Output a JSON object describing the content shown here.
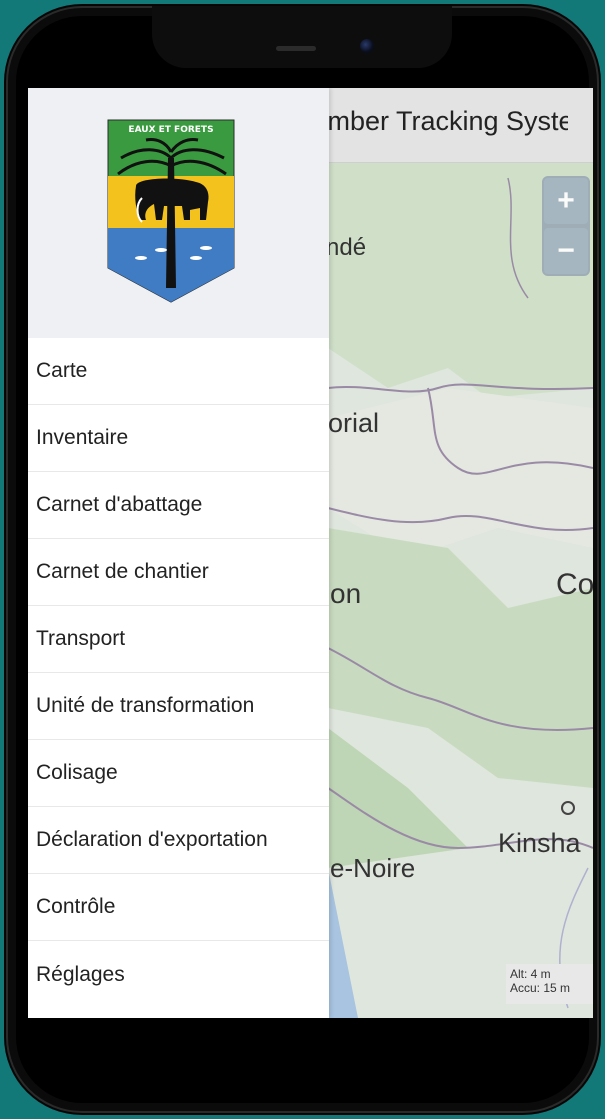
{
  "app": {
    "title_partial": "Timber Tracking System"
  },
  "map": {
    "zoom_in": "+",
    "zoom_out": "−",
    "labels": [
      "ndé",
      "orial",
      "on",
      "Co",
      "Kinsha",
      "e-Noire"
    ],
    "alt_text": "Alt: 4 m",
    "accu_text": "Accu: 15 m"
  },
  "drawer": {
    "emblem_text": "EAUX ET FORETS",
    "items": [
      "Carte",
      "Inventaire",
      "Carnet d'abattage",
      "Carnet de chantier",
      "Transport",
      "Unité de transformation",
      "Colisage",
      "Déclaration d'exportation",
      "Contrôle",
      "Réglages"
    ]
  },
  "colors": {
    "background": "#127878",
    "flag_green": "#3a9a3f",
    "flag_yellow": "#f4c21d",
    "flag_blue": "#3f7cc4"
  }
}
